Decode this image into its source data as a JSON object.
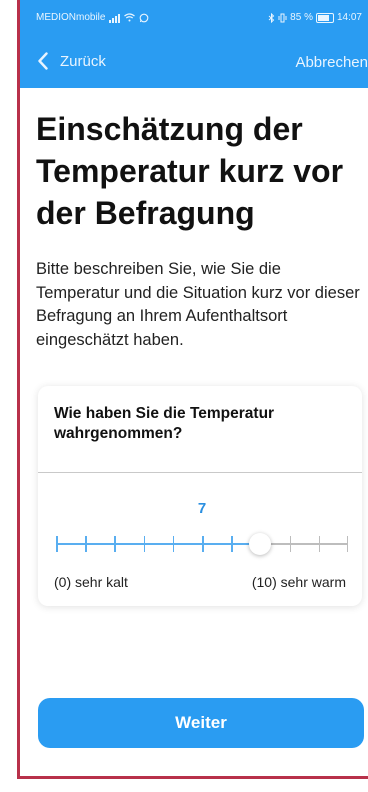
{
  "status_bar": {
    "carrier": "MEDIONmobile",
    "battery": "85 %",
    "time": "14:07"
  },
  "nav": {
    "back_label": "Zurück",
    "cancel_label": "Abbrechen"
  },
  "page": {
    "title": "Einschätzung der Temperatur kurz vor der Befragung",
    "description": "Bitte beschreiben Sie, wie Sie die Temperatur und die Situation kurz vor dieser Befragung an Ihrem Aufenthaltsort eingeschätzt haben."
  },
  "question": {
    "text": "Wie haben Sie die Temperatur wahrgenommen?",
    "value": 7,
    "min": 0,
    "max": 10,
    "min_label": "(0) sehr kalt",
    "max_label": "(10) sehr warm"
  },
  "actions": {
    "next_label": "Weiter"
  },
  "colors": {
    "accent": "#2a9cf2",
    "value_text": "#2a8fe0",
    "frame": "#b8314a"
  }
}
